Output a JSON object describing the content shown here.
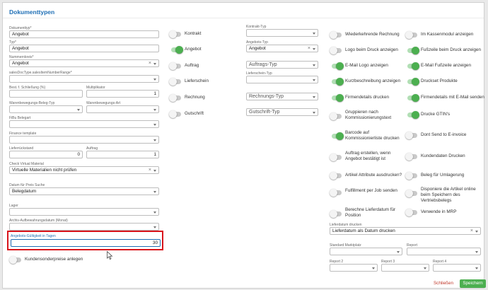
{
  "dialog": {
    "title": "Dokumenttypen",
    "close_label": "Schließen",
    "save_label": "Speichern"
  },
  "form": {
    "dokumenttyp": {
      "label": "Dokumenttyp*",
      "value": "Angebot"
    },
    "typ": {
      "label": "Typ*",
      "value": "Angebot"
    },
    "nummernkreis": {
      "label": "Nummernkreis*",
      "value": "Angebot"
    },
    "sales_doc_type": {
      "label": "salesDocType.salesItemNumberRange*",
      "value": ""
    },
    "best_schliessung": {
      "label": "Best. f. Schließung (%)",
      "value": ""
    },
    "multiplikator": {
      "label": "Multiplikator",
      "value": "1"
    },
    "warenbewegungs_belegtyp": {
      "label": "Warenbewegungs-Beleg-Typ",
      "value": ""
    },
    "warenbewegungs_art": {
      "label": "Warenbewegungs-Art",
      "value": ""
    },
    "fibu_belegart": {
      "label": "FiBu Belegart",
      "value": ""
    },
    "finance_template": {
      "label": "Finance template",
      "value": ""
    },
    "lieferrueckstand": {
      "label": "Lieferrückstand",
      "value": "0"
    },
    "auftrag": {
      "label": "Auftrag",
      "value": "1"
    },
    "check_virtual_material": {
      "label": "Check Virtual Material",
      "value": "Virtuelle Materialien nicht prüfen"
    },
    "datum_preis_suche": {
      "label": "Datum für Preis Suche",
      "value": "Belegdatum"
    },
    "lager": {
      "label": "Lager",
      "value": ""
    },
    "archiv_aufbewahrung": {
      "label": "Archiv-Aufbewahrungsdatum (Monat)",
      "value": ""
    },
    "angebots_gueltigkeit": {
      "label": "Angebots-Gültigkeit in Tagen",
      "value": "30"
    },
    "kundensonderpreise": {
      "label": "Kundensonderpreise anlegen",
      "on": false
    }
  },
  "col2": {
    "toggles": [
      {
        "label": "Kontrakt",
        "on": false
      },
      {
        "label": "Angebot",
        "on": true
      },
      {
        "label": "Auftrag",
        "on": false
      },
      {
        "label": "Lieferschein",
        "on": false
      },
      {
        "label": "Rechnung",
        "on": false
      },
      {
        "label": "Gutschrift",
        "on": false
      }
    ]
  },
  "col3": {
    "kontrakt_typ": {
      "label": "Kontrakt-Typ",
      "value": ""
    },
    "angebots_typ": {
      "label": "Angebots-Typ",
      "value": "Angebot"
    },
    "auftrags_typ": {
      "label": "",
      "value": "Auftrags-Typ"
    },
    "lieferschein_typ": {
      "label": "Lieferschein-Typ",
      "value": ""
    },
    "rechnungs_typ": {
      "label": "",
      "value": "Rechnungs-Typ"
    },
    "gutschrift_typ": {
      "label": "",
      "value": "Gutschrift-Typ"
    },
    "lieferdatum_drucken": {
      "label": "Lieferdatum drucken",
      "value": "Lieferdatum als Datum drucken"
    },
    "standard_marktplatz": {
      "label": "Standard Marktplatz",
      "value": ""
    },
    "report": {
      "label": "Report",
      "value": ""
    },
    "report2": {
      "label": "Report 2",
      "value": ""
    },
    "report3": {
      "label": "Report 3",
      "value": ""
    },
    "report4": {
      "label": "Report 4",
      "value": ""
    }
  },
  "col4": {
    "toggles": [
      {
        "label": "Wiederkehrende Rechnung",
        "on": false
      },
      {
        "label": "Logo beim Druck anzeigen",
        "on": false
      },
      {
        "label": "E-Mail Logo anzeigen",
        "on": true
      },
      {
        "label": "Kurzbeschreibung anzeigen",
        "on": true
      },
      {
        "label": "Firmendetails drucken",
        "on": true
      },
      {
        "label": "Gruppieren nach Kommissionierungstext",
        "on": false
      },
      {
        "label": "Barcode auf Kommissionierliste drucken",
        "on": true
      },
      {
        "label": "Auftrag erstellen, wenn Angebot bestätigt ist",
        "on": false
      },
      {
        "label": "Artikel Attribute ausdrucken?",
        "on": false
      },
      {
        "label": "Fulfillment per Job senden",
        "on": false
      },
      {
        "label": "Berechne Lieferdatum für Position",
        "on": false
      }
    ]
  },
  "col5": {
    "toggles": [
      {
        "label": "Im Kassenmodul anzeigen",
        "on": false
      },
      {
        "label": "Fußzeile beim Druck anzeigen",
        "on": true
      },
      {
        "label": "E-Mail Fußzeile anzeigen",
        "on": true
      },
      {
        "label": "Druckset Produkte",
        "on": true
      },
      {
        "label": "Firmendetails mit E-Mail senden",
        "on": true
      },
      {
        "label": "Drucke GTIN's",
        "on": true
      },
      {
        "label": "Dont Send to E-invoice",
        "on": false
      },
      {
        "label": "Kundendaten Drucken",
        "on": false
      },
      {
        "label": "Beleg für Umlagerung",
        "on": false
      },
      {
        "label": "Disponiere die Artikel online beim Speichern des Vertriebsbelegs",
        "on": false
      },
      {
        "label": "Verwende in MRP",
        "on": false
      }
    ]
  },
  "colors": {
    "accent": "#1f6fb5",
    "toggle_on": "#4caf50",
    "highlight": "#d9141b",
    "close_text": "#c0392b"
  }
}
